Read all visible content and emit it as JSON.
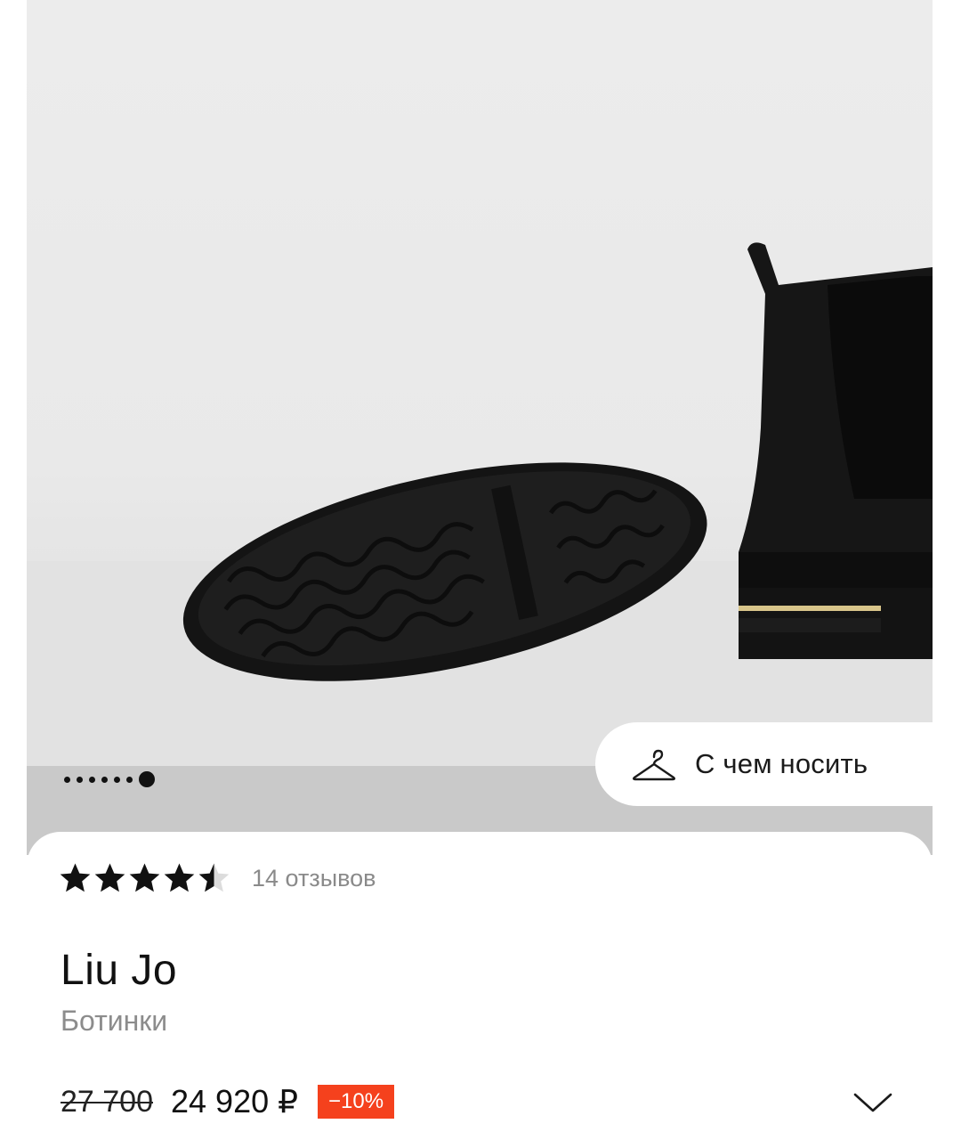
{
  "gallery": {
    "dot_count": 7,
    "active_dot": 7,
    "wear_with_label": "С чем носить",
    "wear_with_icon": "hanger-icon"
  },
  "rating": {
    "value": 4.5,
    "max": 5,
    "reviews_label": "14 отзывов"
  },
  "product": {
    "brand": "Liu Jo",
    "category": "Ботинки"
  },
  "price": {
    "old": "27 700",
    "current": "24 920 ₽",
    "discount": "−10%"
  },
  "colors": {
    "discount_badge": "#f5411d",
    "text_primary": "#111111",
    "text_secondary": "#8c8c8c"
  },
  "icons": {
    "expand": "chevron-down-icon",
    "star": "star-icon"
  }
}
